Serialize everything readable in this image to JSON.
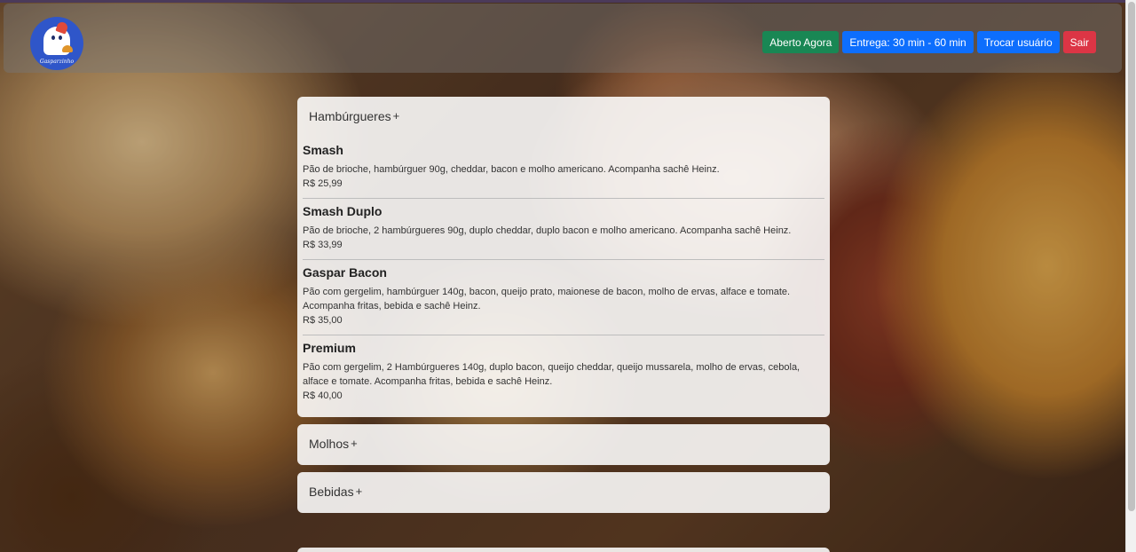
{
  "navbar": {
    "logo_text": "Gasparzinho",
    "buttons": {
      "status": "Aberto Agora",
      "delivery": "Entrega: 30 min - 60 min",
      "switch_user": "Trocar usuário",
      "exit": "Sair"
    },
    "colors": {
      "status": "#198754",
      "primary": "#0d6efd",
      "danger": "#dc3545"
    }
  },
  "menu": {
    "categories": [
      {
        "title": "Hambúrgueres",
        "toggle": "+",
        "items": [
          {
            "name": "Smash",
            "description": "Pão de brioche, hambúrguer 90g, cheddar, bacon e molho americano. Acompanha sachê Heinz.",
            "price": "R$ 25,99"
          },
          {
            "name": "Smash Duplo",
            "description": "Pão de brioche, 2 hambúrgueres 90g, duplo cheddar, duplo bacon e molho americano. Acompanha sachê Heinz.",
            "price": "R$ 33,99"
          },
          {
            "name": "Gaspar Bacon",
            "description": "Pão com gergelim, hambúrguer 140g, bacon, queijo prato, maionese de bacon, molho de ervas, alface e tomate. Acompanha fritas, bebida e sachê Heinz.",
            "price": "R$ 35,00"
          },
          {
            "name": "Premium",
            "description": "Pão com gergelim, 2 Hambúrgueres 140g, duplo bacon, queijo cheddar, queijo mussarela, molho de ervas, cebola, alface e tomate. Acompanha fritas, bebida e sachê Heinz.",
            "price": "R$ 40,00"
          }
        ]
      },
      {
        "title": "Molhos",
        "toggle": "+"
      },
      {
        "title": "Bebidas",
        "toggle": "+"
      }
    ]
  }
}
